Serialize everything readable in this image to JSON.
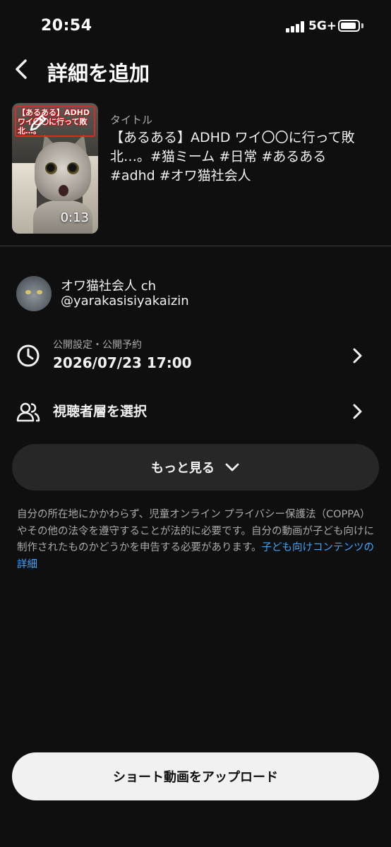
{
  "status_bar": {
    "time": "20:54",
    "network": "5G+"
  },
  "header": {
    "title": "詳細を追加"
  },
  "video": {
    "thumbnail_caption": "【あるある】ADHDワイ〇〇に行って敗北…。",
    "duration": "0:13",
    "title_label": "タイトル",
    "title": "【あるある】ADHD ワイ〇〇に行って敗北…。#猫ミーム #日常 #あるある #adhd #オワ猫社会人"
  },
  "channel": {
    "name": "オワ猫社会人 ch",
    "handle": "@yarakasisiyakaizin"
  },
  "visibility": {
    "label": "公開設定・公開予約",
    "value": "2026/07/23 17:00"
  },
  "audience": {
    "label": "視聴者層を選択"
  },
  "more_button": {
    "label": "もっと見る"
  },
  "notice": {
    "text": "自分の所在地にかかわらず、児童オンライン プライバシー保護法（COPPA）やその他の法令を遵守することが法的に必要です。自分の動画が子ども向けに制作されたものかどうかを申告する必要があります。",
    "link": "子ども向けコンテンツの詳細"
  },
  "upload_button": {
    "label": "ショート動画をアップロード"
  },
  "colors": {
    "background": "#0f0f0f",
    "link": "#3ea6ff",
    "button_dark": "#272727",
    "button_light": "#f1f1f1"
  }
}
